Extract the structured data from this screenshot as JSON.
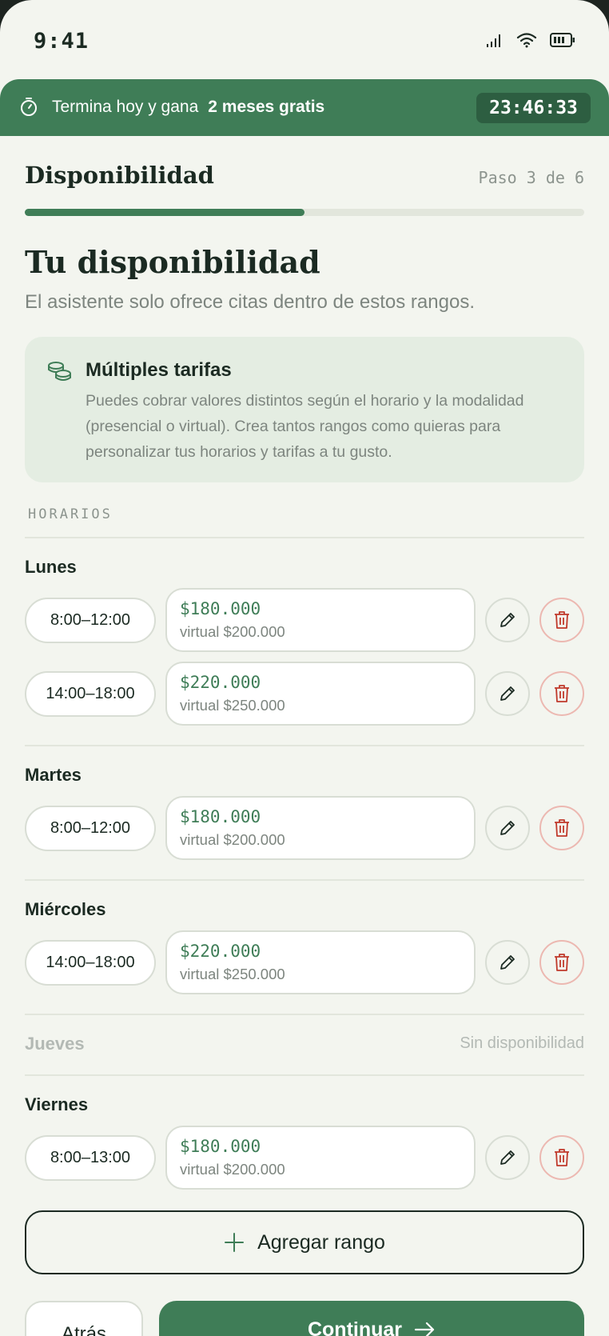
{
  "status_bar": {
    "time": "9:41"
  },
  "promo": {
    "text": "Termina hoy y gana",
    "highlight": "2 meses gratis",
    "countdown": "23:46:33"
  },
  "header": {
    "title": "Disponibilidad",
    "step": "Paso 3 de 6",
    "progress": 0.5
  },
  "main": {
    "title": "Tu disponibilidad",
    "subtitle": "El asistente solo ofrece citas dentro de estos rangos."
  },
  "info_card": {
    "icon": "coins-icon",
    "title": "Múltiples tarifas",
    "body": "Puedes cobrar valores distintos según el horario y la modalidad (presencial o virtual). Crea tantos rangos como quieras para personalizar tus horarios y tarifas a tu gusto."
  },
  "schedule": {
    "section_label": "HORARIOS",
    "no_availability_label": "Sin disponibilidad",
    "days": [
      {
        "name": "Lunes",
        "ranges": [
          {
            "time": "8:00–12:00",
            "price": "$180.000",
            "virtual": "virtual $200.000"
          },
          {
            "time": "14:00–18:00",
            "price": "$220.000",
            "virtual": "virtual $250.000"
          }
        ]
      },
      {
        "name": "Martes",
        "ranges": [
          {
            "time": "8:00–12:00",
            "price": "$180.000",
            "virtual": "virtual $200.000"
          }
        ]
      },
      {
        "name": "Miércoles",
        "ranges": [
          {
            "time": "14:00–18:00",
            "price": "$220.000",
            "virtual": "virtual $250.000"
          }
        ]
      },
      {
        "name": "Jueves",
        "ranges": []
      },
      {
        "name": "Viernes",
        "ranges": [
          {
            "time": "8:00–13:00",
            "price": "$180.000",
            "virtual": "virtual $200.000"
          }
        ]
      }
    ]
  },
  "actions": {
    "add_range": "Agregar rango",
    "back": "Atrás",
    "continue": "Continuar"
  },
  "colors": {
    "accent": "#3f7d57",
    "danger": "#c0392b",
    "background": "#f3f5ef"
  }
}
